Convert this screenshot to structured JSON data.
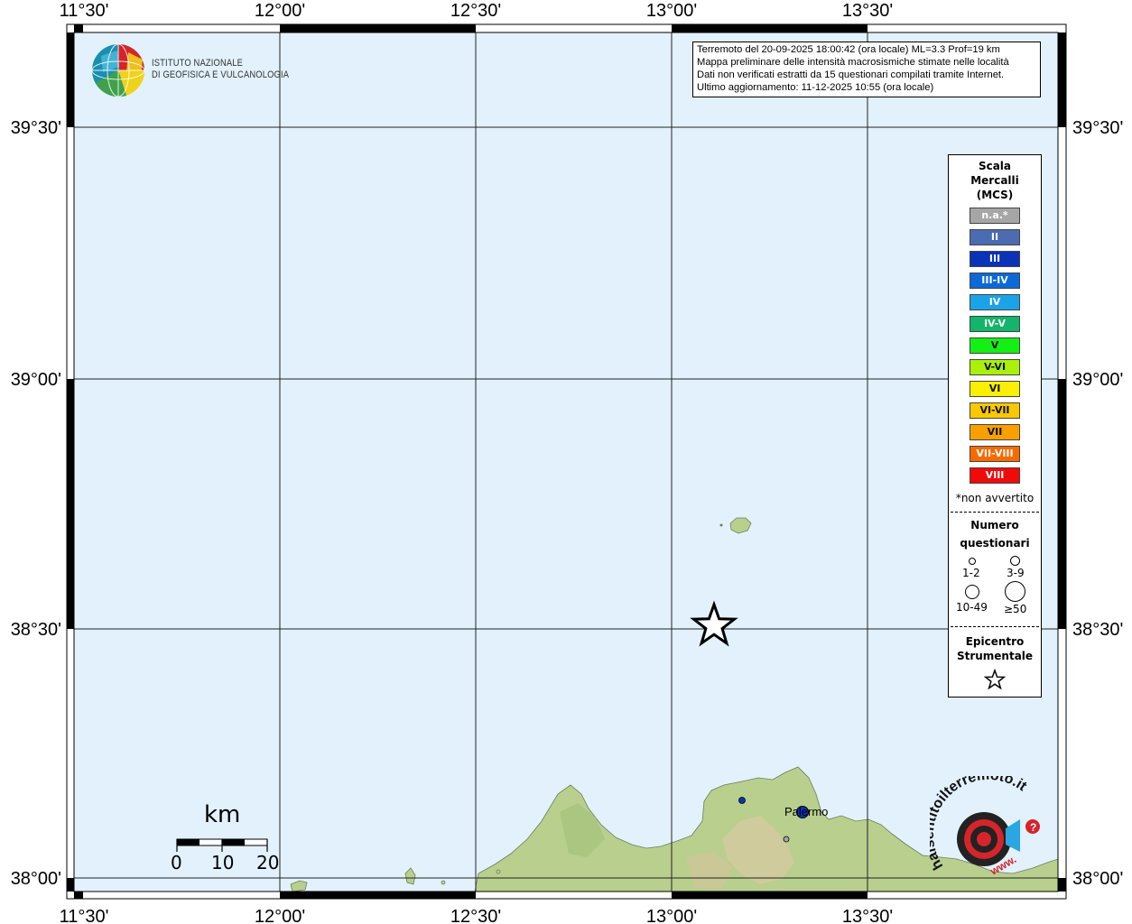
{
  "map": {
    "lon_labels": [
      "11°30'",
      "12°00'",
      "12°30'",
      "13°00'",
      "13°30'"
    ],
    "lat_labels": [
      "39°30'",
      "39°00'",
      "38°30'",
      "38°00'"
    ],
    "sea_color": "#e2f1fc",
    "land_color": "#b9cf8e",
    "place_label": "Palermo"
  },
  "logo": {
    "line1": "ISTITUTO NAZIONALE",
    "line2": "DI GEOFISICA E VULCANOLOGIA",
    "icon": "globe-icon"
  },
  "info": {
    "line1": "Terremoto del 20-09-2025 18:00:42 (ora locale) ML=3.3 Prof=19 km",
    "line2": "Mappa preliminare delle intensità macrosismiche stimate nelle località",
    "line3": "Dati non verificati estratti da 15 questionari compilati tramite Internet.",
    "line4": "Ultimo aggiornamento: 11-12-2025 10:55 (ora locale)"
  },
  "legend": {
    "title1": "Scala",
    "title2": "Mercalli",
    "title3": "(MCS)",
    "items": [
      {
        "label": "n.a.*",
        "color": "#a6a6a6"
      },
      {
        "label": "II",
        "color": "#4b6bb3"
      },
      {
        "label": "III",
        "color": "#0a33b8"
      },
      {
        "label": "III-IV",
        "color": "#0c6ad6"
      },
      {
        "label": "IV",
        "color": "#1aa3e8"
      },
      {
        "label": "IV-V",
        "color": "#12b56a"
      },
      {
        "label": "V",
        "color": "#14f014"
      },
      {
        "label": "V-VI",
        "color": "#aaf00a"
      },
      {
        "label": "VI",
        "color": "#f8f000"
      },
      {
        "label": "VI-VII",
        "color": "#f8c800"
      },
      {
        "label": "VII",
        "color": "#f8a000"
      },
      {
        "label": "VII-VIII",
        "color": "#f86a00"
      },
      {
        "label": "VIII",
        "color": "#f00a0a"
      }
    ],
    "note": "*non avvertito",
    "count_title1": "Numero",
    "count_title2": "questionari",
    "counts": [
      "1-2",
      "3-9",
      "10-49",
      "≥50"
    ],
    "epi_title1": "Epicentro",
    "epi_title2": "Strumentale"
  },
  "scale_bar": {
    "unit": "km",
    "labels": [
      "0",
      "10",
      "20"
    ]
  },
  "badge": {
    "text": "haisentitoilterremoto.it",
    "url": "www."
  }
}
